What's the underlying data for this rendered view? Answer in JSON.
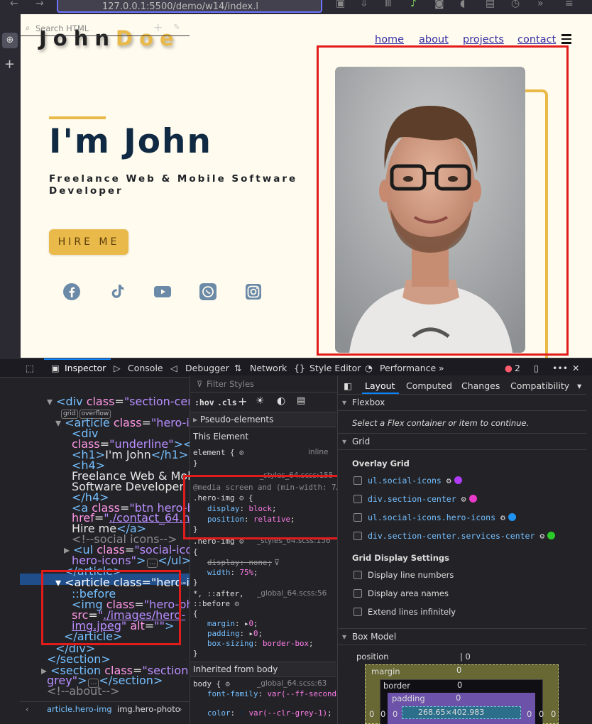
{
  "browser": {
    "url": "127.0.0.1:5500/demo/w14/index.l"
  },
  "site": {
    "logo_main": "John",
    "logo_accent": "Doe",
    "nav": [
      "home",
      "about",
      "projects",
      "contact"
    ],
    "hero_title": "I'm John",
    "hero_subtitle": "Freelance Web & Mobile Software Developer",
    "hire_label": "HIRE ME",
    "social_icons": [
      "facebook-icon",
      "tiktok-icon",
      "youtube-icon",
      "whatsapp-icon",
      "instagram-icon"
    ],
    "accent_color": "#e9b949",
    "title_color": "#102a43"
  },
  "devtools": {
    "tabs": [
      "Inspector",
      "Console",
      "Debugger",
      "Network",
      "Style Editor",
      "Performance"
    ],
    "error_count": "2",
    "search_placeholder": "Search HTML",
    "html_lines": [
      {
        "open": "<div ",
        "attr": "class",
        "val": "\"section-center\"",
        "close": ">",
        "badges": [
          "grid",
          "overflow"
        ]
      },
      {
        "open": "<article ",
        "attr": "class",
        "val": "\"hero-info\"",
        "close": ">"
      },
      {
        "text": "<div"
      },
      {
        "text": "class=\"underline\"></div>"
      },
      {
        "text": "<h1>I'm John</h1>"
      },
      {
        "text": "<h4>"
      },
      {
        "text": "Freelance Web & Mobile"
      },
      {
        "text": "Software Developer"
      },
      {
        "text": "</h4>"
      },
      {
        "text": "<a class=\"btn hero-btn\""
      },
      {
        "text": "href=\"./contact_64.html\">"
      },
      {
        "text": "Hire me</a>"
      },
      {
        "text": "<!--social icons-->"
      },
      {
        "text": "<ul class=\"social-icons"
      },
      {
        "text": "hero-icons\">…</ul>"
      },
      {
        "text": "</article>"
      },
      {
        "text": "<article class=\"hero-img\">"
      },
      {
        "text": "::before"
      },
      {
        "text": "<img class=\"hero-photo\""
      },
      {
        "text": "src=\"./images/hero-"
      },
      {
        "text": "img.jpeg\" alt=\"\">"
      },
      {
        "text": "</article>"
      },
      {
        "text": "</div>"
      },
      {
        "text": "</section>"
      },
      {
        "text": "<section class=\"section bg-"
      },
      {
        "text": "grey\">…</section>"
      },
      {
        "text": "<!--about-->"
      }
    ],
    "breadcrumbs": [
      "article.hero-img",
      "img.hero-photo"
    ],
    "styles": {
      "filter_placeholder": "Filter Styles",
      "hov": ":hov",
      "cls": ".cls",
      "pseudo": "Pseudo-elements",
      "this_element": "This Element",
      "element_rule": "element {",
      "inline": "inline",
      "file1": "_styles_64.scss:155",
      "media": "@media screen and (min-width: 7…",
      "selector1": ".hero-img",
      "decl1a": [
        "display",
        "block"
      ],
      "decl1b": [
        "position",
        "relative"
      ],
      "file2": "_styles_64.scss:156",
      "decl2a": [
        "display",
        "none"
      ],
      "decl2b": [
        "width",
        "75%"
      ],
      "universal": "*, ::after,",
      "universal2": "::before",
      "file3": "_global_64.scss:56",
      "decl3a": [
        "margin",
        "0"
      ],
      "decl3b": [
        "padding",
        "0"
      ],
      "decl3c": [
        "box-sizing",
        "border-box"
      ],
      "inherited": "Inherited from body",
      "body_rule": "body {",
      "file4": "_global_64.scss:63",
      "decl4a": [
        "font-family",
        "var(--ff-secondary)"
      ],
      "decl4b": [
        "color",
        "var(--clr-grey-1)"
      ]
    },
    "layout": {
      "tabs": [
        "Layout",
        "Computed",
        "Changes",
        "Compatibility"
      ],
      "flexbox_title": "Flexbox",
      "flexbox_hint": "Select a Flex container or item to continue.",
      "grid_title": "Grid",
      "overlay_title": "Overlay Grid",
      "overlay_items": [
        {
          "label": "ul.social-icons",
          "color": "#b13bf6"
        },
        {
          "label": "div.section-center",
          "color": "#e83ac8"
        },
        {
          "label": "ul.social-icons.hero-icons",
          "color": "#1f93f3"
        },
        {
          "label": "div.section-center.services-center",
          "color": "#2bcb29"
        }
      ],
      "display_settings_title": "Grid Display Settings",
      "settings": [
        "Display line numbers",
        "Display area names",
        "Extend lines infinitely"
      ],
      "boxmodel_title": "Box Model",
      "bm_position": "position",
      "bm_margin": "margin",
      "bm_border": "border",
      "bm_padding": "padding",
      "bm_size": "268.65×402.983",
      "bm_zero": "0"
    }
  }
}
